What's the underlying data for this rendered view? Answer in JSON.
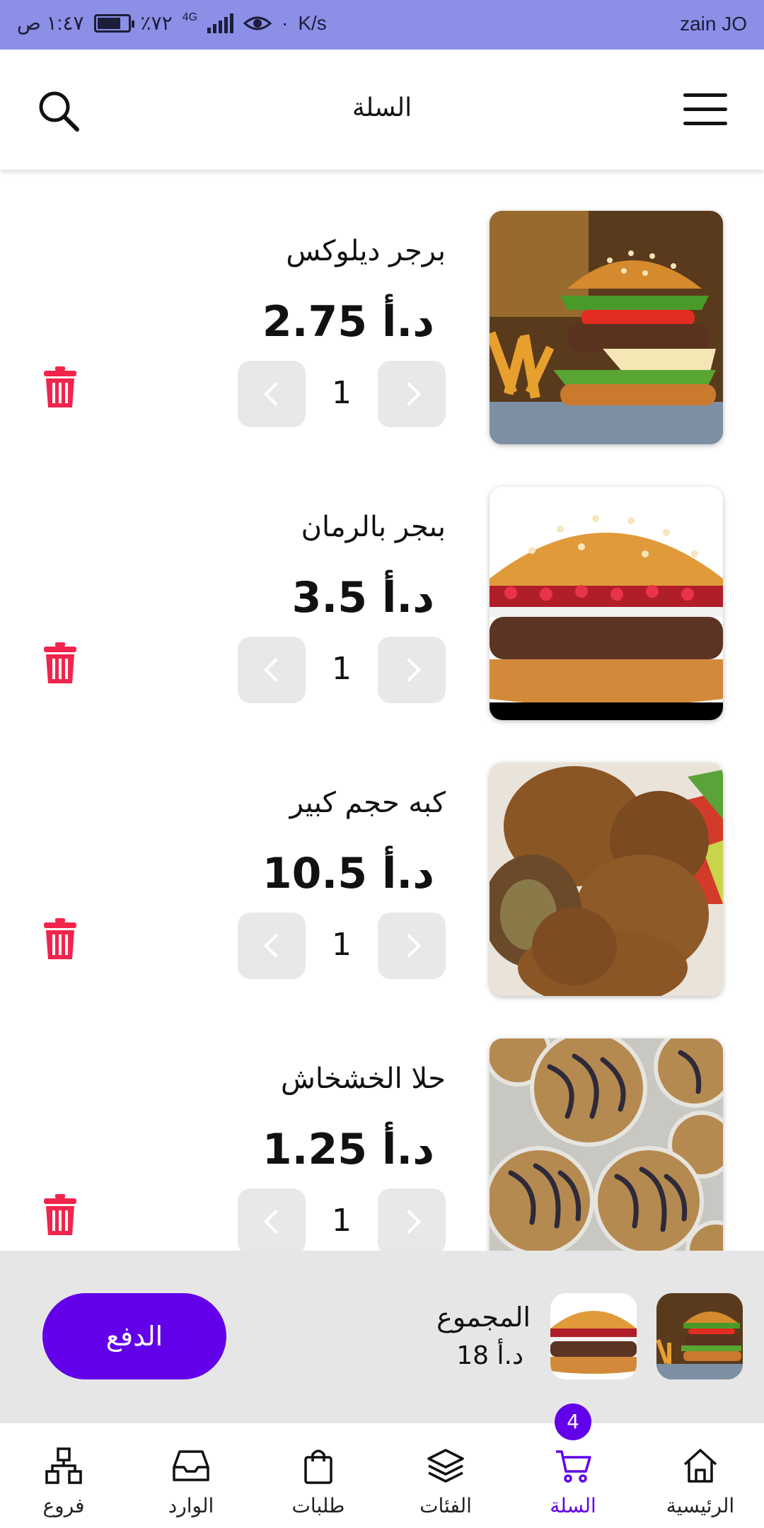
{
  "status_bar": {
    "carrier": "zain JO",
    "time": "١:٤٧ ص",
    "battery": "٪٧٢",
    "network": "4G",
    "speed": "K/s",
    "battery_level": 0.72
  },
  "header": {
    "title": "السلة"
  },
  "cart": {
    "items": [
      {
        "name": "برجر ديلوكس",
        "price": "د.أ 2.75",
        "qty": "1"
      },
      {
        "name": "بىجر بالرمان",
        "price": "د.أ 3.5",
        "qty": "1"
      },
      {
        "name": "كبه حجم كبير",
        "price": "د.أ 10.5",
        "qty": "1"
      },
      {
        "name": "حلا الخشخاش",
        "price": "د.أ 1.25",
        "qty": "1"
      }
    ]
  },
  "summary": {
    "total_label": "المجموع",
    "total_value": "د.أ 18",
    "pay_label": "الدفع"
  },
  "bottom_nav": {
    "items": [
      {
        "label": "الرئيسية",
        "icon": "home-icon"
      },
      {
        "label": "السلة",
        "icon": "cart-icon",
        "badge": "4",
        "active": true
      },
      {
        "label": "الفئات",
        "icon": "layers-icon"
      },
      {
        "label": "طلبات",
        "icon": "bag-icon"
      },
      {
        "label": "الوارد",
        "icon": "inbox-icon"
      },
      {
        "label": "فروع",
        "icon": "branches-icon"
      }
    ]
  },
  "colors": {
    "accent": "#6200ea",
    "delete": "#f0244c",
    "status_bar": "#8b8fe6",
    "summary_bg": "#e6e6e6"
  }
}
